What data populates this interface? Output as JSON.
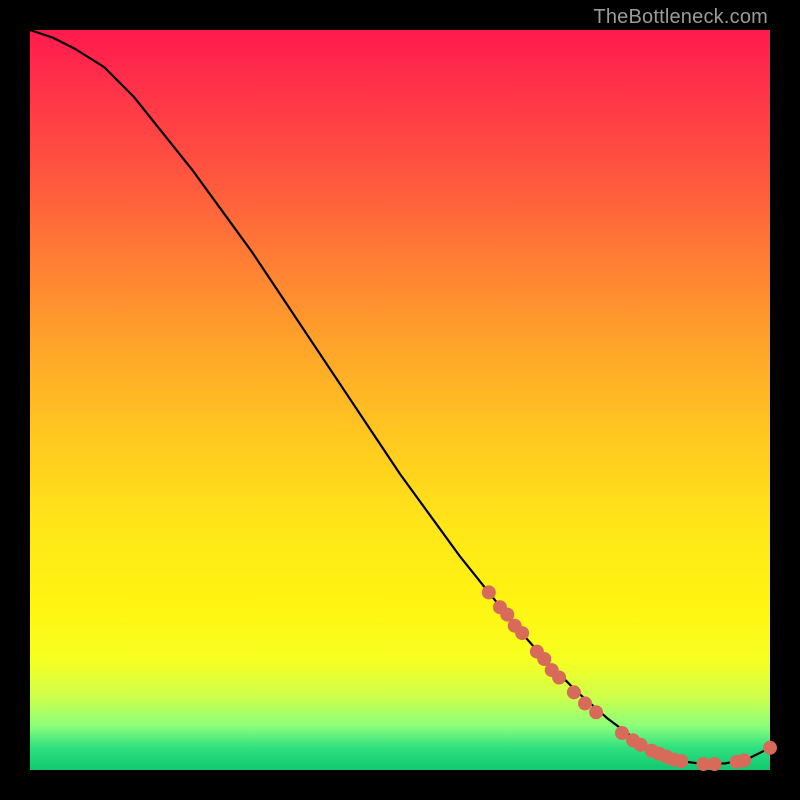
{
  "attribution": "TheBottleneck.com",
  "colors": {
    "background": "#000000",
    "curve": "#000000",
    "point": "#d86a5a",
    "attribution_text": "#9a9a9a"
  },
  "chart_data": {
    "type": "line",
    "title": "",
    "xlabel": "",
    "ylabel": "",
    "xlim": [
      0,
      100
    ],
    "ylim": [
      0,
      100
    ],
    "grid": false,
    "legend": false,
    "series": [
      {
        "name": "curve",
        "x": [
          0,
          3,
          6,
          10,
          14,
          18,
          22,
          26,
          30,
          34,
          38,
          42,
          46,
          50,
          54,
          58,
          62,
          66,
          70,
          74,
          78,
          82,
          85,
          88,
          91,
          94,
          97,
          100
        ],
        "y": [
          100,
          99,
          97.5,
          95,
          91,
          86,
          81,
          75.5,
          70,
          64,
          58,
          52,
          46,
          40,
          34.5,
          29,
          24,
          19,
          14.5,
          10.5,
          7,
          4,
          2.3,
          1.2,
          0.8,
          0.9,
          1.5,
          3
        ]
      }
    ],
    "scatter_points": [
      {
        "x": 62.0,
        "y": 24.0
      },
      {
        "x": 63.5,
        "y": 22.0
      },
      {
        "x": 64.5,
        "y": 21.0
      },
      {
        "x": 65.5,
        "y": 19.5
      },
      {
        "x": 66.5,
        "y": 18.5
      },
      {
        "x": 68.5,
        "y": 16.0
      },
      {
        "x": 69.5,
        "y": 15.0
      },
      {
        "x": 70.5,
        "y": 13.5
      },
      {
        "x": 71.5,
        "y": 12.5
      },
      {
        "x": 73.5,
        "y": 10.5
      },
      {
        "x": 75.0,
        "y": 9.0
      },
      {
        "x": 76.5,
        "y": 7.8
      },
      {
        "x": 80.0,
        "y": 5.0
      },
      {
        "x": 81.5,
        "y": 4.0
      },
      {
        "x": 82.5,
        "y": 3.4
      },
      {
        "x": 84.0,
        "y": 2.6
      },
      {
        "x": 85.0,
        "y": 2.2
      },
      {
        "x": 86.0,
        "y": 1.8
      },
      {
        "x": 87.0,
        "y": 1.4
      },
      {
        "x": 88.0,
        "y": 1.2
      },
      {
        "x": 91.0,
        "y": 0.8
      },
      {
        "x": 92.5,
        "y": 0.8
      },
      {
        "x": 95.5,
        "y": 1.1
      },
      {
        "x": 96.5,
        "y": 1.3
      },
      {
        "x": 100.0,
        "y": 3.0
      }
    ]
  }
}
